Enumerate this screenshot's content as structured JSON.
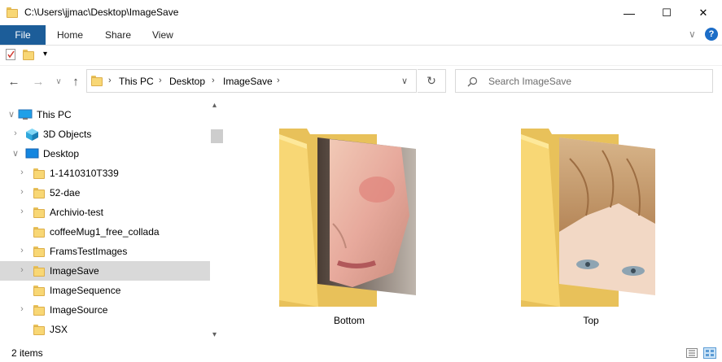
{
  "window": {
    "title": "C:\\Users\\jjmac\\Desktop\\ImageSave",
    "minimize_glyph": "—",
    "maximize_glyph": "☐",
    "close_glyph": "✕"
  },
  "ribbon": {
    "tabs": [
      "File",
      "Home",
      "Share",
      "View"
    ],
    "expand_glyph": "∨",
    "help_glyph": "?"
  },
  "quick_access": {
    "dropdown_glyph": "▾"
  },
  "nav": {
    "back": "←",
    "forward": "→",
    "recent": "∨",
    "up": "↑",
    "breadcrumb": [
      "This PC",
      "Desktop",
      "ImageSave"
    ],
    "address_dropdown": "∨",
    "refresh": "↻",
    "search_placeholder": "Search ImageSave"
  },
  "tree": {
    "items": [
      {
        "label": "This PC",
        "icon": "pc-icon",
        "level": 0,
        "expander": "∨",
        "selected": false
      },
      {
        "label": "3D Objects",
        "icon": "3d-objects-icon",
        "level": 1,
        "expander": "›",
        "selected": false
      },
      {
        "label": "Desktop",
        "icon": "desktop-icon",
        "level": 1,
        "expander": "∨",
        "selected": false
      },
      {
        "label": "1-1410310T339",
        "icon": "folder-icon",
        "level": 2,
        "expander": "›",
        "selected": false
      },
      {
        "label": "52-dae",
        "icon": "folder-icon",
        "level": 2,
        "expander": "›",
        "selected": false
      },
      {
        "label": "Archivio-test",
        "icon": "folder-icon",
        "level": 2,
        "expander": "›",
        "selected": false
      },
      {
        "label": "coffeeMug1_free_collada",
        "icon": "folder-icon",
        "level": 2,
        "expander": "",
        "selected": false
      },
      {
        "label": "FramsTestImages",
        "icon": "folder-icon",
        "level": 2,
        "expander": "›",
        "selected": false
      },
      {
        "label": "ImageSave",
        "icon": "folder-icon",
        "level": 2,
        "expander": "›",
        "selected": true
      },
      {
        "label": "ImageSequence",
        "icon": "folder-icon",
        "level": 2,
        "expander": "",
        "selected": false
      },
      {
        "label": "ImageSource",
        "icon": "folder-icon",
        "level": 2,
        "expander": "›",
        "selected": false
      },
      {
        "label": "JSX",
        "icon": "folder-icon",
        "level": 2,
        "expander": "",
        "selected": false
      }
    ],
    "scroll_up": "▴",
    "scroll_down": "▾"
  },
  "content": {
    "items": [
      {
        "label": "Bottom",
        "thumbnail": "face-lower-half-photo"
      },
      {
        "label": "Top",
        "thumbnail": "face-upper-half-photo"
      }
    ]
  },
  "status": {
    "count": "2 items"
  },
  "colors": {
    "file_tab": "#1c5d99",
    "selection": "#d9d9d9",
    "folder": "#f8d775"
  }
}
